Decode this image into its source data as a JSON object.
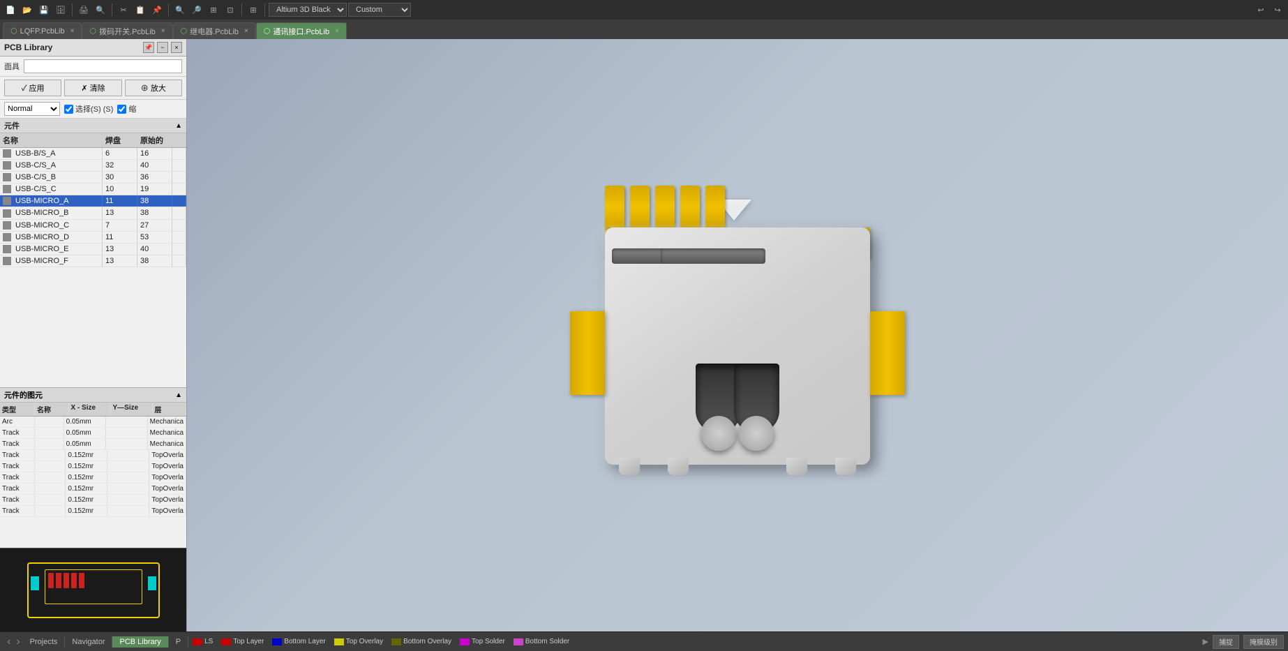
{
  "app": {
    "title": "PCB Library",
    "toolbar_theme": "Altium 3D Black",
    "toolbar_style": "Custom"
  },
  "tabs": [
    {
      "label": "LQFP.PcbLib",
      "active": false,
      "icon": "pcb-icon"
    },
    {
      "label": "拨码开关.PcbLib",
      "active": false,
      "icon": "pcb-icon"
    },
    {
      "label": "继电器.PcbLib",
      "active": false,
      "icon": "pcb-icon"
    },
    {
      "label": "通讯接口.PcbLib",
      "active": true,
      "icon": "pcb-icon"
    }
  ],
  "panel": {
    "title": "PCB Library",
    "mask_label": "面具",
    "mask_placeholder": "",
    "buttons": {
      "apply": "✓ 应用",
      "clear": "✗ 清除",
      "zoom": "⊕ 放大"
    },
    "filter": {
      "mode": "Normal",
      "checkbox1_label": "选择(S) (S)",
      "checkbox2_label": "缩"
    }
  },
  "components": {
    "section_title": "元件",
    "headers": [
      "名称",
      "焊盘",
      "原始的"
    ],
    "items": [
      {
        "name": "USB-B/S_A",
        "pads": "6",
        "primitives": "16"
      },
      {
        "name": "USB-C/S_A",
        "pads": "32",
        "primitives": "40"
      },
      {
        "name": "USB-C/S_B",
        "pads": "30",
        "primitives": "36"
      },
      {
        "name": "USB-C/S_C",
        "pads": "10",
        "primitives": "19"
      },
      {
        "name": "USB-MICRO_A",
        "pads": "11",
        "primitives": "38",
        "selected": true
      },
      {
        "name": "USB-MICRO_B",
        "pads": "13",
        "primitives": "38"
      },
      {
        "name": "USB-MICRO_C",
        "pads": "7",
        "primitives": "27"
      },
      {
        "name": "USB-MICRO_D",
        "pads": "11",
        "primitives": "53"
      },
      {
        "name": "USB-MICRO_E",
        "pads": "13",
        "primitives": "40"
      },
      {
        "name": "USB-MICRO_F",
        "pads": "13",
        "primitives": "38"
      }
    ]
  },
  "graphics": {
    "section_title": "元件的图元",
    "headers": [
      "类型",
      "名称",
      "X - Size",
      "Y—Size",
      "层"
    ],
    "items": [
      {
        "type": "Arc",
        "name": "",
        "x_size": "0.05mm",
        "y_size": "",
        "layer": "Mechanica"
      },
      {
        "type": "Track",
        "name": "",
        "x_size": "0.05mm",
        "y_size": "",
        "layer": "Mechanica"
      },
      {
        "type": "Track",
        "name": "",
        "x_size": "0.05mm",
        "y_size": "",
        "layer": "Mechanica"
      },
      {
        "type": "Track",
        "name": "",
        "x_size": "0.152mr",
        "y_size": "",
        "layer": "TopOverla"
      },
      {
        "type": "Track",
        "name": "",
        "x_size": "0.152mr",
        "y_size": "",
        "layer": "TopOverla"
      },
      {
        "type": "Track",
        "name": "",
        "x_size": "0.152mr",
        "y_size": "",
        "layer": "TopOverla"
      },
      {
        "type": "Track",
        "name": "",
        "x_size": "0.152mr",
        "y_size": "",
        "layer": "TopOverla"
      },
      {
        "type": "Track",
        "name": "",
        "x_size": "0.152mr",
        "y_size": "",
        "layer": "TopOverla"
      },
      {
        "type": "Track",
        "name": "",
        "x_size": "0.152mr",
        "y_size": "",
        "layer": "TopOverla"
      }
    ]
  },
  "status_bar": {
    "tabs": [
      "Projects",
      "Navigator",
      "PCB Library",
      "P"
    ],
    "active_tab": "PCB Library",
    "layers": [
      {
        "color": "#cc0000",
        "label": "LS"
      },
      {
        "color": "#cc0000",
        "label": "Top Layer"
      },
      {
        "color": "#0000cc",
        "label": "Bottom Layer"
      },
      {
        "color": "#cccc00",
        "label": "Top Overlay"
      },
      {
        "color": "#666600",
        "label": "Bottom Overlay"
      },
      {
        "color": "#cc00cc",
        "label": "Top Solder"
      },
      {
        "color": "#cc44cc",
        "label": "Bottom Solder"
      }
    ],
    "right_buttons": [
      "捕捉",
      "掩膜级别"
    ]
  }
}
